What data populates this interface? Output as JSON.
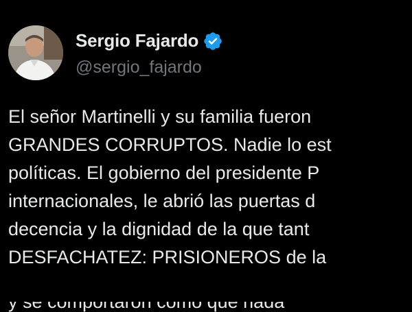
{
  "tweet": {
    "author": {
      "display_name": "Sergio Fajardo",
      "handle": "@sergio_fajardo",
      "verified_icon": "verified-badge-icon",
      "avatar": "profile-photo"
    },
    "text_lines": [
      "El señor Martinelli y su familia fueron",
      "GRANDES CORRUPTOS. Nadie lo est",
      "políticas. El gobierno del presidente P",
      "internacionales, le abrió las puertas d",
      "decencia y  la dignidad de la que tant",
      "DESFACHATEZ: PRISIONEROS  de la"
    ],
    "partial_line": "y se comportaron como que nada"
  },
  "colors": {
    "background": "#000000",
    "text": "#e7e9ea",
    "handle": "#71767b",
    "verified": "#1d9bf0"
  }
}
